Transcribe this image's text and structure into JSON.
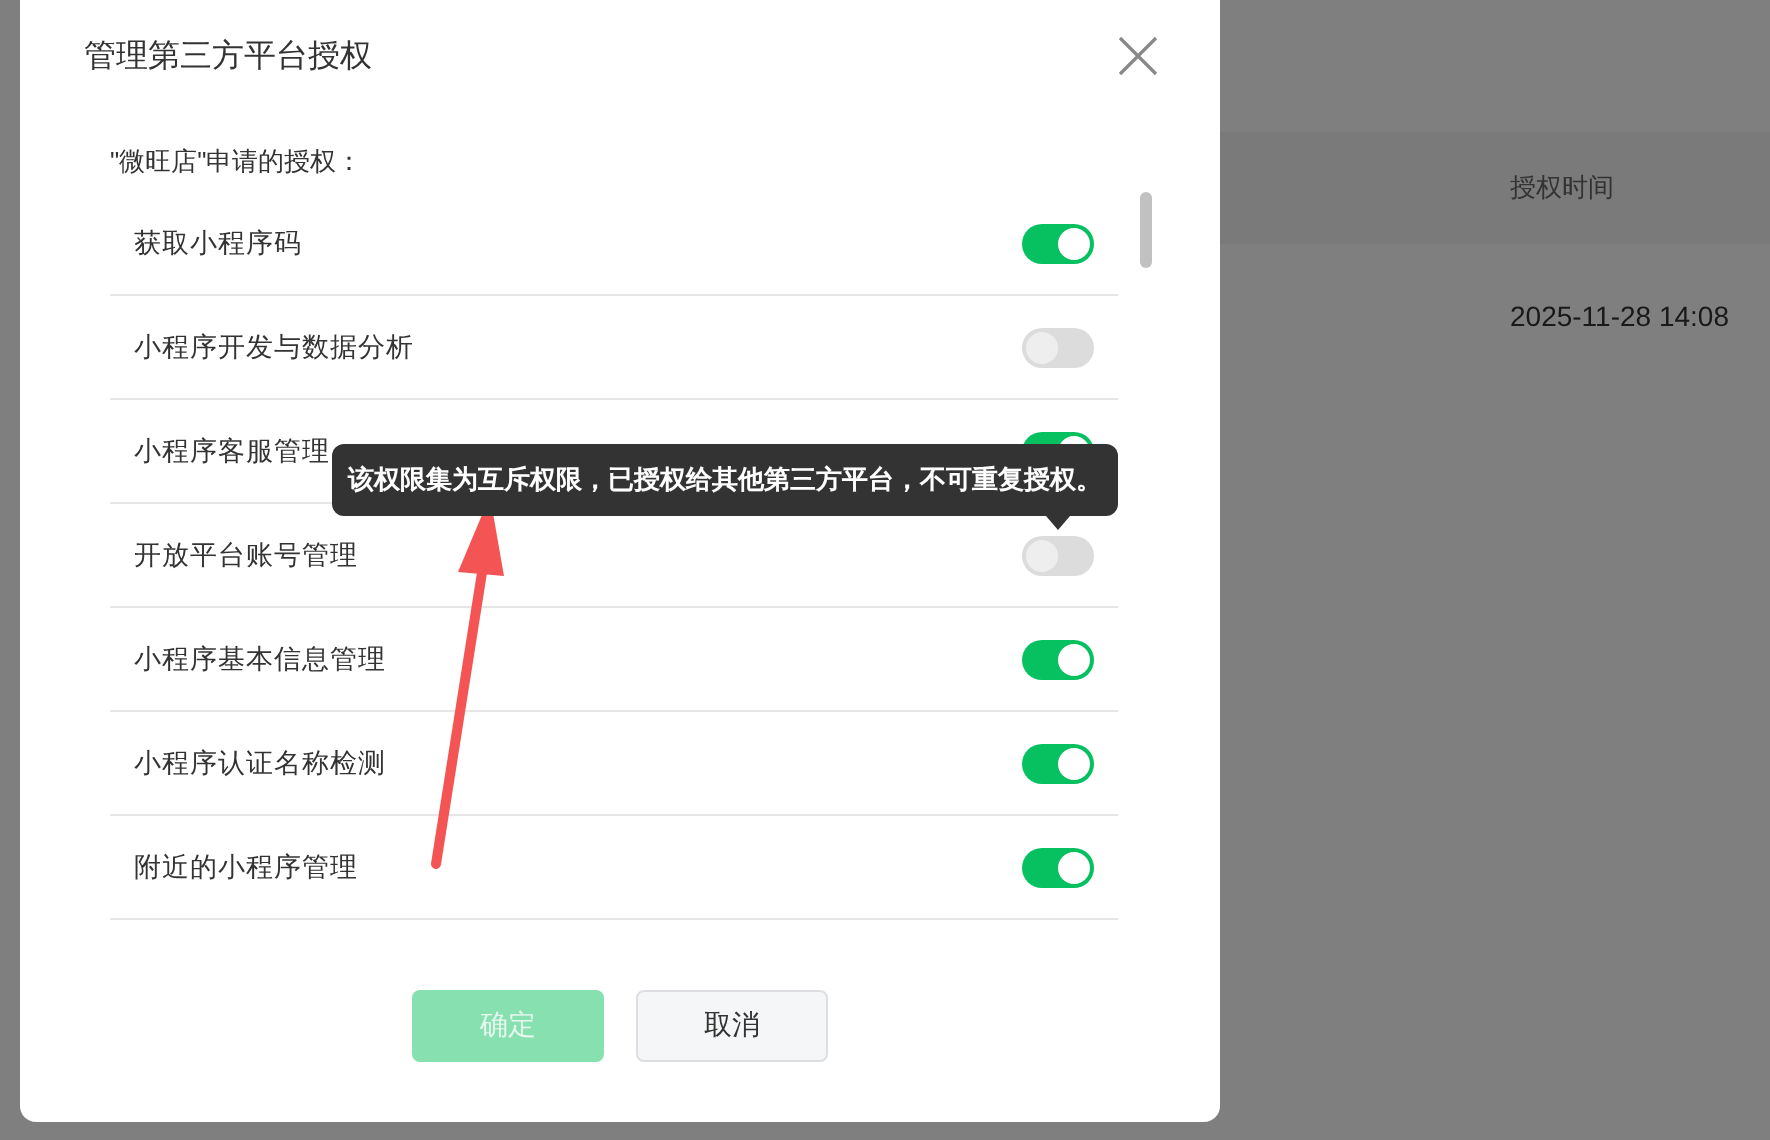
{
  "background_page": {
    "table": {
      "columns": [
        "授权时间"
      ],
      "rows": [
        [
          "2025-11-28 14:08"
        ]
      ]
    }
  },
  "dialog": {
    "title": "管理第三方平台授权",
    "subtitle": "\"微旺店\"申请的授权：",
    "rows": [
      {
        "label": "获取小程序码",
        "on": true
      },
      {
        "label": "小程序开发与数据分析",
        "on": false
      },
      {
        "label": "小程序客服管理",
        "on": true
      },
      {
        "label": "开放平台账号管理",
        "on": false,
        "tooltip": "该权限集为互斥权限，已授权给其他第三方平台，不可重复授权。"
      },
      {
        "label": "小程序基本信息管理",
        "on": true
      },
      {
        "label": "小程序认证名称检测",
        "on": true
      },
      {
        "label": "附近的小程序管理",
        "on": true
      }
    ],
    "buttons": [
      {
        "label": "确定",
        "kind": "primary",
        "disabled": true
      },
      {
        "label": "取消",
        "kind": "secondary",
        "disabled": false
      }
    ]
  }
}
